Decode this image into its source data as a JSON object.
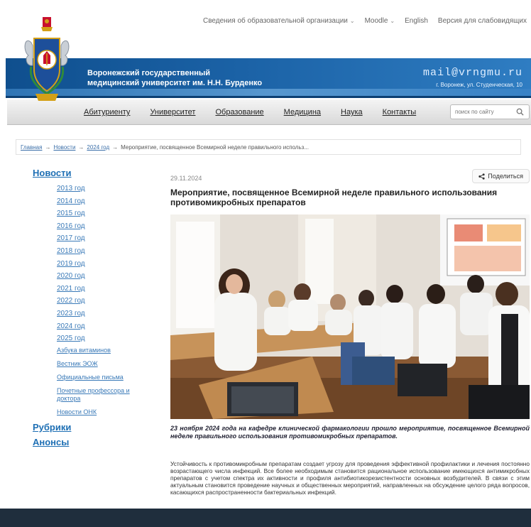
{
  "top_nav": {
    "items": [
      {
        "label": "Сведения об образовательной организации",
        "has_dropdown": true
      },
      {
        "label": "Moodle",
        "has_dropdown": true
      },
      {
        "label": "English",
        "has_dropdown": false
      },
      {
        "label": "Версия для слабовидящих",
        "has_dropdown": false
      }
    ]
  },
  "header": {
    "university_name_line1": "Воронежский государственный",
    "university_name_line2": "медицинский университет им. Н.Н. Бурденко",
    "email": "mail@vrngmu.ru",
    "address": "г. Воронеж, ул. Студенческая, 10"
  },
  "main_nav": {
    "items": [
      "Абитуриенту",
      "Университет",
      "Образование",
      "Медицина",
      "Наука",
      "Контакты"
    ],
    "search_placeholder": "поиск по сайту"
  },
  "breadcrumb": {
    "items": [
      "Главная",
      "Новости",
      "2024 год"
    ],
    "separator": "→",
    "current": "Мероприятие, посвященное Всемирной неделе правильного использ..."
  },
  "sidebar": {
    "news_heading": "Новости",
    "years": [
      "2013 год",
      "2014 год",
      "2015 год",
      "2016 год",
      "2017 год",
      "2018 год",
      "2019 год",
      "2020 год",
      "2021 год",
      "2022 год",
      "2023 год",
      "2024 год",
      "2025 год"
    ],
    "sublinks": [
      "Азбука витаминов",
      "Вестник ЭОЖ",
      "Официальные письма",
      "Почетные профессора и доктора",
      "Новости ОНК"
    ],
    "rubrics_heading": "Рубрики",
    "announcements_heading": "Анонсы"
  },
  "article": {
    "date": "29.11.2024",
    "share_label": "Поделиться",
    "title": "Мероприятие, посвященное Всемирной неделе правильного использования противомикробных препаратов",
    "lead": "23 ноября 2024 года на кафедре клинической фармакологии прошло мероприятие, посвященное Всемирной неделе правильного использования противомикробных препаратов.",
    "body": "Устойчивость к противомикробным препаратам создает угрозу для проведения эффективной профилактики и лечения постоянно возрастающего числа инфекций. Все более необходимым становится рациональное использование имеющихся антимикробных препаратов с учетом спектра их активности и профиля антибиотикорезистентности основных возбудителей. В связи с этим актуальным становится проведение научных и общественных мероприятий, направленных на обсуждение целого ряда вопросов, касающихся распространенности бактериальных инфекций."
  },
  "colors": {
    "banner_blue": "#1b62a6",
    "link_blue": "#3a7ab8",
    "footer": "#1f2e3d"
  }
}
